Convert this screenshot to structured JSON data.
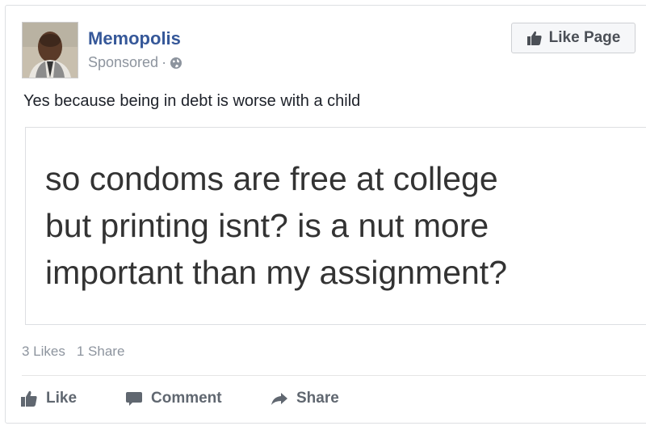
{
  "post": {
    "page_name": "Memopolis",
    "sponsored_label": "Sponsored",
    "separator": "·",
    "like_page_label": "Like Page",
    "text": "Yes because being in debt is worse with a child",
    "meme_lines": [
      "so condoms are free at college",
      "but printing isnt? is a nut more",
      "important than my assignment?"
    ],
    "likes_count": "3 Likes",
    "shares_count": "1 Share"
  },
  "actions": {
    "like_label": "Like",
    "comment_label": "Comment",
    "share_label": "Share"
  },
  "colors": {
    "page_name": "#365899",
    "action_text": "#606770",
    "muted": "#8d949e"
  },
  "icons": {
    "audience": "globe-icon",
    "like": "thumbs-up-icon",
    "comment": "speech-bubble-icon",
    "share": "share-arrow-icon"
  }
}
